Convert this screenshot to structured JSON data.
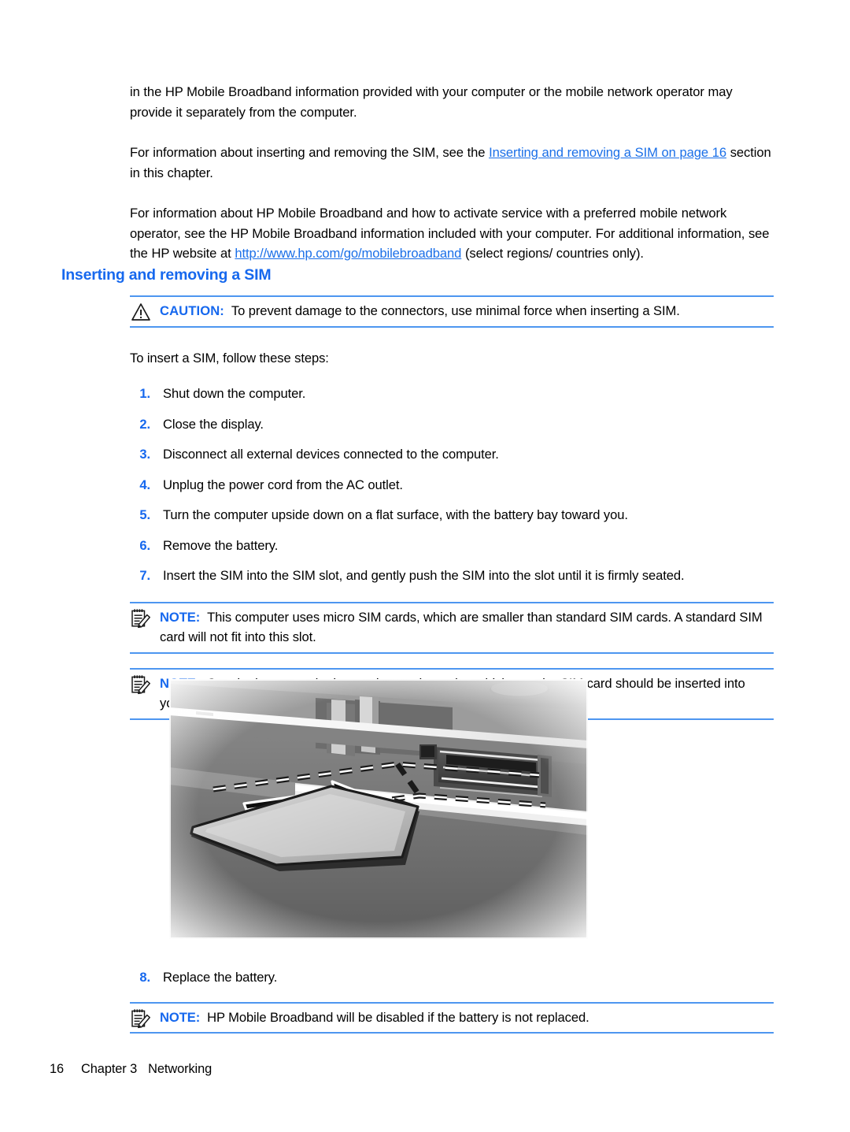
{
  "document": {
    "paragraphs": {
      "p1": "in the HP Mobile Broadband information provided with your computer or the mobile network operator may provide it separately from the computer.",
      "p2_before": "For information about inserting and removing the SIM, see the ",
      "p2_link": "Inserting and removing a SIM on page 16",
      "p2_after": " section in this chapter.",
      "p3_before": "For information about HP Mobile Broadband and how to activate service with a preferred mobile network operator, see the HP Mobile Broadband information included with your computer. For additional information, see the HP website at ",
      "p3_link": "http://www.hp.com/go/mobilebroadband",
      "p3_after": " (select regions/ countries only)."
    },
    "heading": "Inserting and removing a SIM",
    "caution": {
      "label": "CAUTION:",
      "text": "To prevent damage to the connectors, use minimal force when inserting a SIM.",
      "icon": "warning-triangle-icon"
    },
    "lead_in": "To insert a SIM, follow these steps:",
    "steps": [
      {
        "num": "1.",
        "text": "Shut down the computer."
      },
      {
        "num": "2.",
        "text": "Close the display."
      },
      {
        "num": "3.",
        "text": "Disconnect all external devices connected to the computer."
      },
      {
        "num": "4.",
        "text": "Unplug the power cord from the AC outlet."
      },
      {
        "num": "5.",
        "text": "Turn the computer upside down on a flat surface, with the battery bay toward you."
      },
      {
        "num": "6.",
        "text": "Remove the battery."
      },
      {
        "num": "7.",
        "text": "Insert the SIM into the SIM slot, and gently push the SIM into the slot until it is firmly seated."
      }
    ],
    "notes": [
      {
        "label": "NOTE:",
        "text": "This computer uses micro SIM cards, which are smaller than standard SIM cards. A standard SIM card will not fit into this slot.",
        "icon": "note-pad-pencil-icon"
      },
      {
        "label": "NOTE:",
        "text": "See the image on the battery bay to determine which way the SIM card should be inserted into your computer.",
        "icon": "note-pad-pencil-icon"
      }
    ],
    "figure": {
      "alt": "Illustration of inserting a SIM card into the SIM slot inside the battery bay of a laptop computer"
    },
    "final_step": {
      "num": "8.",
      "text": "Replace the battery."
    },
    "final_note": {
      "label": "NOTE:",
      "text": "HP Mobile Broadband will be disabled if the battery is not replaced.",
      "icon": "note-pad-pencil-icon"
    },
    "footer": {
      "page_number": "16",
      "chapter": "Chapter 3",
      "chapter_title": "Networking"
    }
  },
  "colors": {
    "link": "#1a6fe8",
    "heading": "#1668ee",
    "rule": "#4d96f0",
    "text": "#000000"
  }
}
